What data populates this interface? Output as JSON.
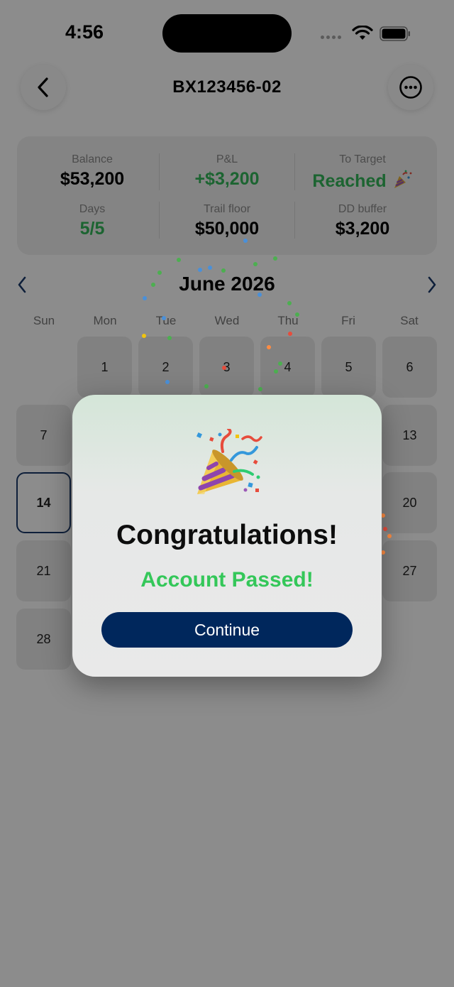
{
  "status_bar": {
    "time": "4:56"
  },
  "header": {
    "title": "BX123456-02"
  },
  "stats": {
    "balance_label": "Balance",
    "balance_value": "$53,200",
    "pnl_label": "P&L",
    "pnl_value": "+$3,200",
    "target_label": "To Target",
    "target_value": "Reached",
    "days_label": "Days",
    "days_value": "5/5",
    "trail_label": "Trail floor",
    "trail_value": "$50,000",
    "dd_label": "DD buffer",
    "dd_value": "$3,200"
  },
  "calendar": {
    "month": "June 2026",
    "weekdays": [
      "Sun",
      "Mon",
      "Tue",
      "Wed",
      "Thu",
      "Fri",
      "Sat"
    ],
    "days": [
      "1",
      "2",
      "3",
      "4",
      "5",
      "6",
      "7",
      "13",
      "14",
      "20",
      "21",
      "27",
      "28"
    ],
    "selected_day": "14"
  },
  "modal": {
    "title": "Congratulations!",
    "subtitle": "Account Passed!",
    "button_label": "Continue"
  },
  "colors": {
    "success": "#34c759",
    "button": "#00275c",
    "selected_border": "#1a3a6a"
  },
  "icons": {
    "back": "chevron-left-icon",
    "more": "ellipsis-circle-icon",
    "party": "party-popper-icon",
    "prev_month": "chevron-left-icon",
    "next_month": "chevron-right-icon"
  }
}
